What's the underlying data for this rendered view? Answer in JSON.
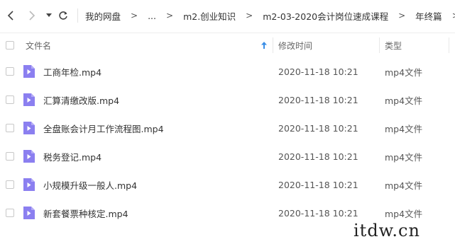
{
  "toolbar": {
    "back_icon": "chevron-left-icon",
    "forward_icon": "chevron-right-icon",
    "dropdown_icon": "caret-down-icon",
    "refresh_icon": "refresh-icon"
  },
  "breadcrumb": {
    "items": [
      "我的网盘",
      "...",
      "m2.创业知识",
      "m2-03-2020会计岗位速成课程",
      "年终篇"
    ],
    "separator": ">"
  },
  "table": {
    "headers": {
      "name": "文件名",
      "modified": "修改时间",
      "type": "类型"
    },
    "sort_icon": "arrow-up-icon",
    "accent_color": "#3a8ee6",
    "file_icon_color": "#8b7ff0",
    "rows": [
      {
        "name": "工商年检.mp4",
        "modified": "2020-11-18 10:21",
        "type": "mp4文件"
      },
      {
        "name": "汇算清缴改版.mp4",
        "modified": "2020-11-18 10:21",
        "type": "mp4文件"
      },
      {
        "name": "全盘账会计月工作流程图.mp4",
        "modified": "2020-11-18 10:21",
        "type": "mp4文件"
      },
      {
        "name": "税务登记.mp4",
        "modified": "2020-11-18 10:21",
        "type": "mp4文件"
      },
      {
        "name": "小规模升级一般人.mp4",
        "modified": "2020-11-18 10:21",
        "type": "mp4文件"
      },
      {
        "name": "新套餐票种核定.mp4",
        "modified": "2020-11-18 10:21",
        "type": "mp4文件"
      }
    ]
  },
  "watermark": {
    "text": "itdw.cn"
  }
}
